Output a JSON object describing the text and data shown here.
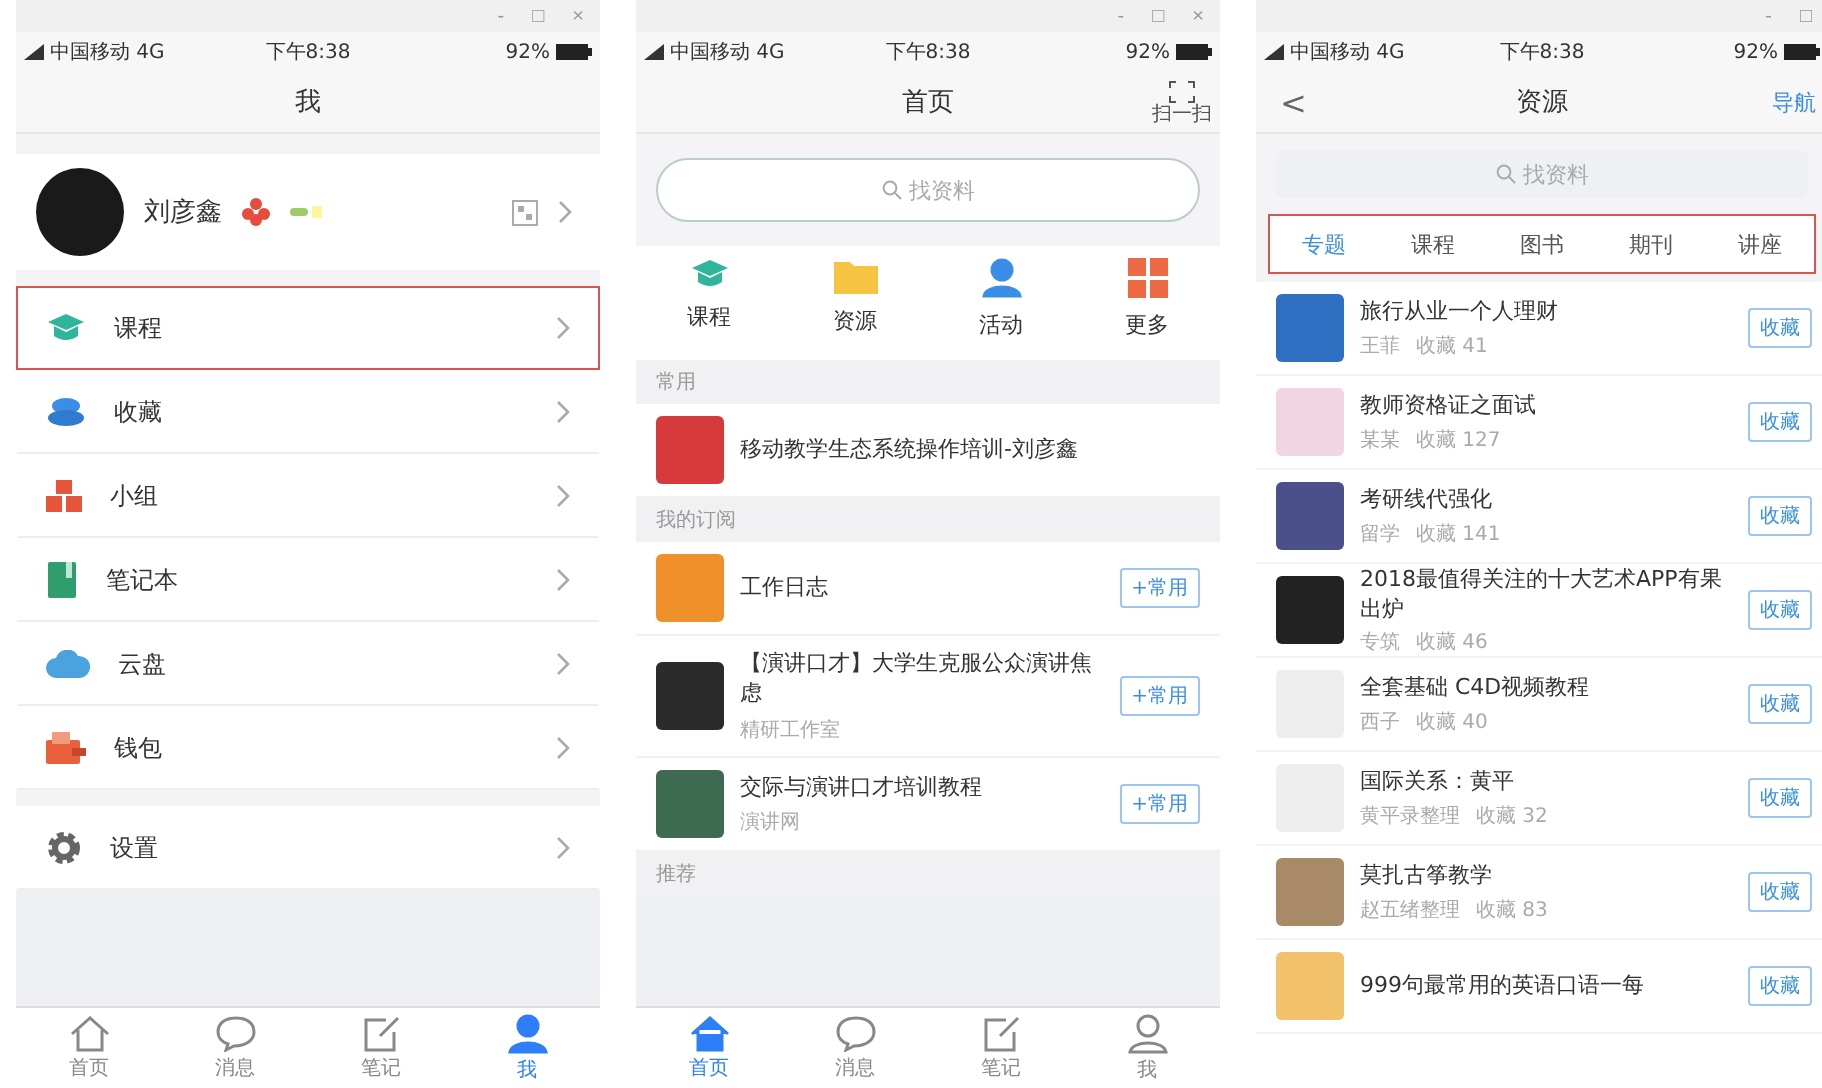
{
  "me_screen": {
    "window_controls": [
      "-",
      "□",
      "×"
    ],
    "status_bar": {
      "carrier": "中国移动 4G",
      "time": "下午8:38",
      "battery": "92%"
    },
    "title": "我",
    "profile": {
      "name": "刘彦鑫"
    },
    "menu": [
      {
        "label": "课程",
        "highlighted": true
      },
      {
        "label": "收藏",
        "highlighted": false
      },
      {
        "label": "小组",
        "highlighted": false
      },
      {
        "label": "笔记本",
        "highlighted": false
      },
      {
        "label": "云盘",
        "highlighted": false
      },
      {
        "label": "钱包",
        "highlighted": false
      }
    ],
    "settings": {
      "label": "设置",
      "highlighted": false
    },
    "tab_bar": [
      {
        "label": "首页",
        "selected": false
      },
      {
        "label": "消息",
        "selected": false
      },
      {
        "label": "笔记",
        "selected": false
      },
      {
        "label": "我",
        "selected": true
      }
    ]
  },
  "home_screen": {
    "window_controls": [
      "-",
      "□",
      "×"
    ],
    "status_bar": {
      "carrier": "中国移动 4G",
      "time": "下午8:38",
      "battery": "92%"
    },
    "title": "首页",
    "scan_label": "扫一扫",
    "search": {
      "placeholder": "找资料"
    },
    "shortcuts": [
      {
        "label": "课程"
      },
      {
        "label": "资源"
      },
      {
        "label": "活动"
      },
      {
        "label": "更多"
      }
    ],
    "sections": [
      {
        "header": "常用",
        "items": [
          {
            "title": "移动教学生态系统操作培训-刘彦鑫"
          }
        ]
      },
      {
        "header": "我的订阅",
        "items": [
          {
            "title": "工作日志",
            "button": "+常用"
          },
          {
            "title": "【演讲口才】大学生克服公众演讲焦虑",
            "subtitle": "精研工作室",
            "button": "+常用"
          },
          {
            "title": "交际与演讲口才培训教程",
            "subtitle": "演讲网",
            "button": "+常用"
          }
        ]
      },
      {
        "header": "推荐"
      }
    ],
    "tab_bar": [
      {
        "label": "首页",
        "selected": true
      },
      {
        "label": "消息",
        "selected": false
      },
      {
        "label": "笔记",
        "selected": false
      },
      {
        "label": "我",
        "selected": false
      }
    ]
  },
  "resources_screen": {
    "window_controls": [
      "-",
      "□"
    ],
    "status_bar": {
      "carrier": "中国移动 4G",
      "time": "下午8:38",
      "battery": "92%"
    },
    "title": "资源",
    "back": "<",
    "right_action": "导航",
    "search": {
      "placeholder": "找资料"
    },
    "tabs_highlighted": true,
    "tabs": [
      {
        "label": "专题",
        "selected": true
      },
      {
        "label": "课程",
        "selected": false
      },
      {
        "label": "图书",
        "selected": false
      },
      {
        "label": "期刊",
        "selected": false
      },
      {
        "label": "讲座",
        "selected": false
      }
    ],
    "items": [
      {
        "title": "旅行从业一个人理财",
        "author": "王菲",
        "saves": "收藏 41",
        "button": "收藏"
      },
      {
        "title": "教师资格证之面试",
        "author": "某某",
        "saves": "收藏 127",
        "button": "收藏"
      },
      {
        "title": "考研线代强化",
        "author": "留学",
        "saves": "收藏 141",
        "button": "收藏"
      },
      {
        "title": "2018最值得关注的十大艺术APP有果出炉",
        "author": "专筑",
        "saves": "收藏 46",
        "button": "收藏"
      },
      {
        "title": "全套基础 C4D视频教程",
        "author": "西子",
        "saves": "收藏 40",
        "button": "收藏"
      },
      {
        "title": "国际关系：黄平",
        "author": "黄平录整理",
        "saves": "收藏 32",
        "button": "收藏"
      },
      {
        "title": "莫扎古筝教学",
        "author": "赵五绪整理",
        "saves": "收藏 83",
        "button": "收藏"
      },
      {
        "title": "999句最常用的英语口语一每",
        "button": "收藏"
      }
    ]
  }
}
